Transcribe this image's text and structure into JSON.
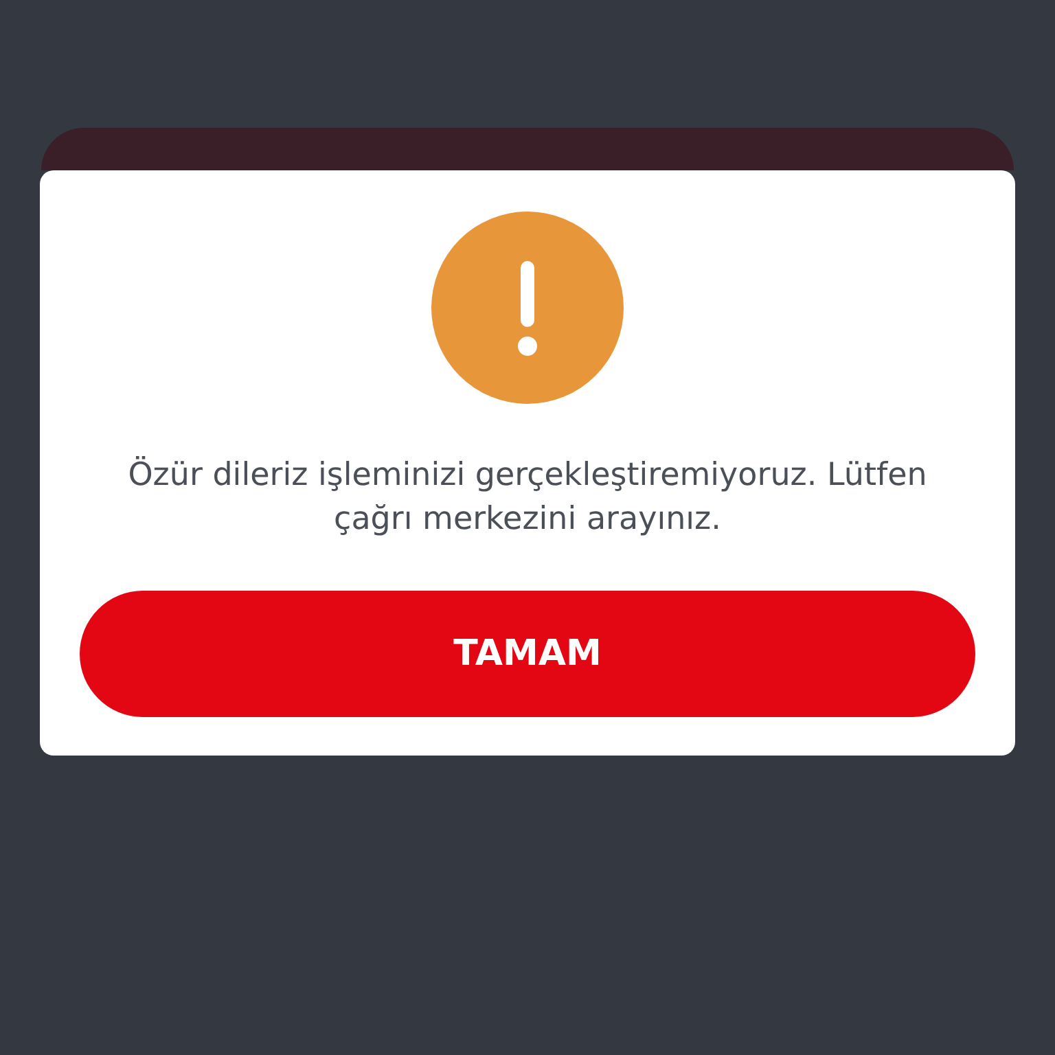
{
  "dialog": {
    "message": "Özür dileriz işleminizi gerçekleştiremiyoruz. Lütfen çağrı merkezini arayınız.",
    "button": "TAMAM"
  }
}
